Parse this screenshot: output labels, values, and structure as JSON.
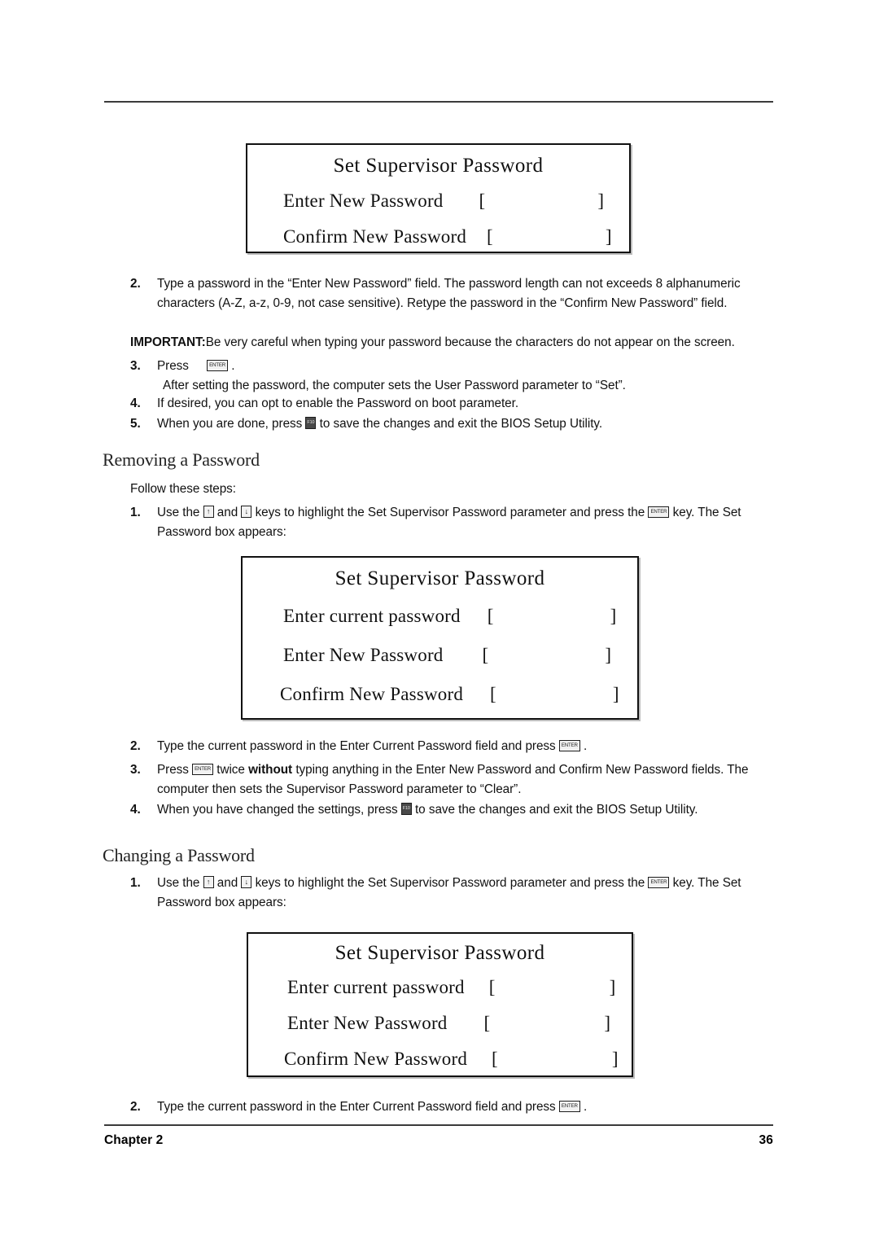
{
  "document": {
    "footer": {
      "chapter": "Chapter 2",
      "page_number": "36"
    }
  },
  "dialog_1": {
    "name": "set-supervisor-password-dialog",
    "title": "Set Supervisor Password",
    "rows": [
      {
        "label": "Enter New Password",
        "open_bracket": "[",
        "value": "",
        "close_bracket": "]"
      },
      {
        "label": "Confirm New Password",
        "open_bracket": "[",
        "value": "",
        "close_bracket": "]"
      }
    ]
  },
  "dialog_2": {
    "name": "set-supervisor-password-dialog",
    "title": "Set Supervisor Password",
    "rows": [
      {
        "label": "Enter current password",
        "open_bracket": "[",
        "value": "",
        "close_bracket": "]"
      },
      {
        "label": "Enter New Password",
        "open_bracket": "[",
        "value": "",
        "close_bracket": "]"
      },
      {
        "label": "Confirm New Password",
        "open_bracket": "[",
        "value": "",
        "close_bracket": "]"
      }
    ]
  },
  "dialog_3": {
    "name": "set-supervisor-password-dialog",
    "title": "Set Supervisor Password",
    "rows": [
      {
        "label": "Enter current password",
        "open_bracket": "[",
        "value": "",
        "close_bracket": "]"
      },
      {
        "label": "Enter New Password",
        "open_bracket": "[",
        "value": "",
        "close_bracket": "]"
      },
      {
        "label": "Confirm New Password",
        "open_bracket": "[",
        "value": "",
        "close_bracket": "]"
      }
    ]
  },
  "setting_section": {
    "step2_num": "2.",
    "step2_text": "Type a password in the “Enter New Password” field. The password length can not exceeds 8 alphanumeric characters (A-Z, a-z, 0-9, not case sensitive). Retype the password in the “Confirm New Password” field.",
    "important_label": "IMPORTANT:",
    "important_text": "Be very careful when typing your password because the characters do not appear on the screen.",
    "step3_num": "3.",
    "step3_text_a": "Press",
    "step3_text_b": ".",
    "step3_text_c": "After setting the password, the computer sets the User Password parameter to “Set”.",
    "step4_num": "4.",
    "step4_text": "If desired, you can opt to enable the Password on boot parameter.",
    "step5_num": "5.",
    "step5_text_a": "When you are done, press",
    "step5_text_b": "to save the changes and exit the BIOS Setup Utility."
  },
  "removing_section": {
    "heading": "Removing a Password",
    "intro": "Follow these steps:",
    "step1_num": "1.",
    "step1_a": "Use the",
    "step1_b": "and",
    "step1_c": "keys to highlight the Set Supervisor Password parameter and press the",
    "step1_d": "key. The Set Password box appears:",
    "step2_num": "2.",
    "step2_a": "Type the current password in the Enter Current Password field and press",
    "step2_b": ".",
    "step3_num": "3.",
    "step3_a": "Press",
    "step3_b": "twice",
    "step3_bold": "without",
    "step3_c": "typing anything in the Enter New Password and Confirm New Password fields. The computer then sets the Supervisor Password parameter to “Clear”.",
    "step4_num": "4.",
    "step4_a": "When you have changed the settings, press",
    "step4_b": "to save the changes and exit the BIOS Setup Utility."
  },
  "changing_section": {
    "heading": "Changing a Password",
    "step1_num": "1.",
    "step1_a": "Use the",
    "step1_b": "and",
    "step1_c": "keys to highlight the Set Supervisor Password parameter and press the",
    "step1_d": "key. The Set Password box appears:",
    "step2_num": "2.",
    "step2_a": "Type the current password in the Enter Current Password field and press",
    "step2_b": "."
  },
  "keys": {
    "enter_label": "ENTER",
    "f10_label": "F10",
    "up_arrow": "↑",
    "down_arrow": "↓"
  }
}
